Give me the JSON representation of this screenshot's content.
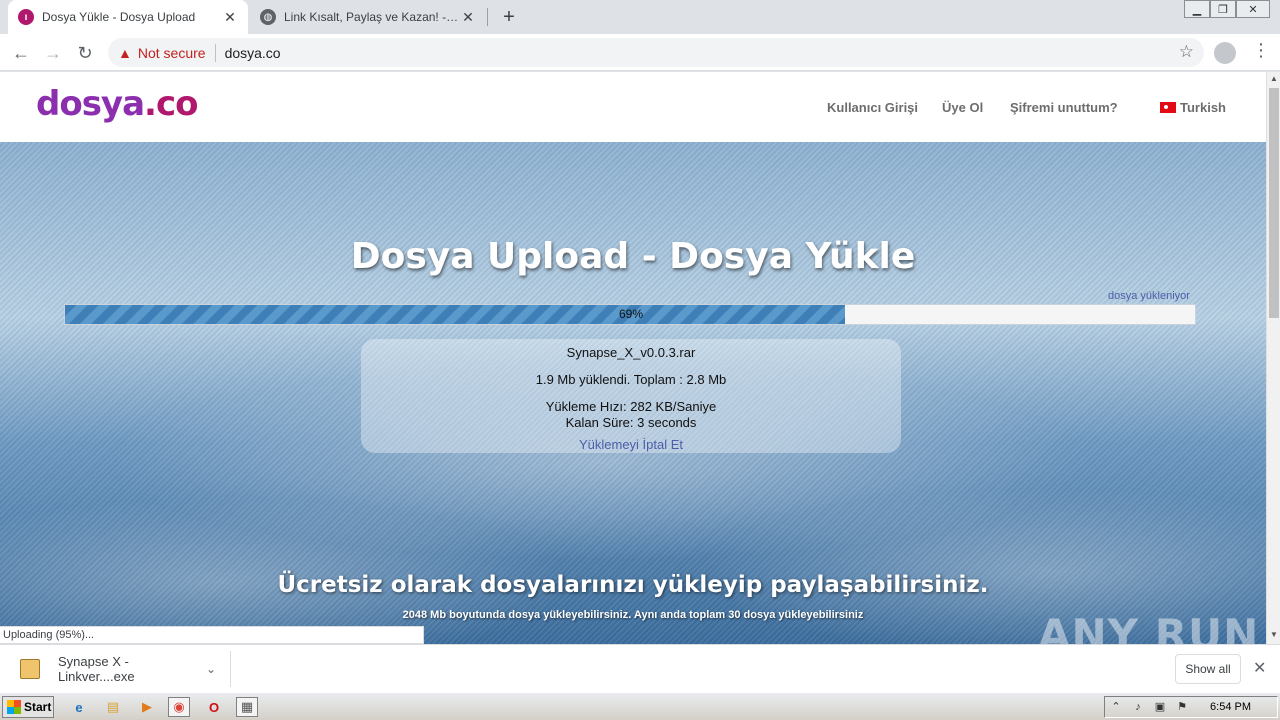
{
  "browser": {
    "tabs": [
      {
        "title": "Dosya Yükle - Dosya Upload",
        "active": true,
        "favicon": "dosya-favicon-icon"
      },
      {
        "title": "Link Kısalt, Paylaş ve Kazan! - TIK.LA",
        "active": false,
        "favicon": "globe-icon"
      }
    ],
    "new_tab_glyph": "+",
    "security_label": "Not secure",
    "url": "dosya.co"
  },
  "site": {
    "logo_part1": "dosya",
    "logo_part2": ".co",
    "nav": {
      "login": "Kullanıcı Girişi",
      "register": "Üye Ol",
      "forgot": "Şifremi unuttum?",
      "language": "Turkish"
    }
  },
  "upload": {
    "heading": "Dosya Upload - Dosya Yükle",
    "status_word": "dosya yükleniyor",
    "progress_percent": 69,
    "progress_label": "69%",
    "file_name": "Synapse_X_v0.0.3.rar",
    "uploaded_text": "1.9 Mb yüklendi. Toplam : 2.8 Mb",
    "speed_text": "Yükleme Hızı: 282 KB/Saniye",
    "remaining_text": "Kalan Süre: 3 seconds",
    "cancel_label": "Yüklemeyi İptal Et"
  },
  "hero": {
    "tagline": "Ücretsiz olarak dosyalarınızı yükleyip paylaşabilirsiniz.",
    "subtagline": "2048 Mb boyutunda dosya yükleyebilirsiniz. Aynı anda toplam 30 dosya yükleyebilirsiniz"
  },
  "status_bubble": "Uploading (95%)...",
  "watermark": "ANY RUN",
  "download_shelf": {
    "file_name": "Synapse X - Linkver....exe",
    "show_all": "Show all"
  },
  "taskbar": {
    "start_label": "Start",
    "clock": "6:54 PM"
  },
  "colors": {
    "brand_purple": "#8b2fae",
    "brand_magenta": "#b0186d",
    "progress_blue": "#3d7fb6",
    "warning_red": "#c5221f"
  }
}
